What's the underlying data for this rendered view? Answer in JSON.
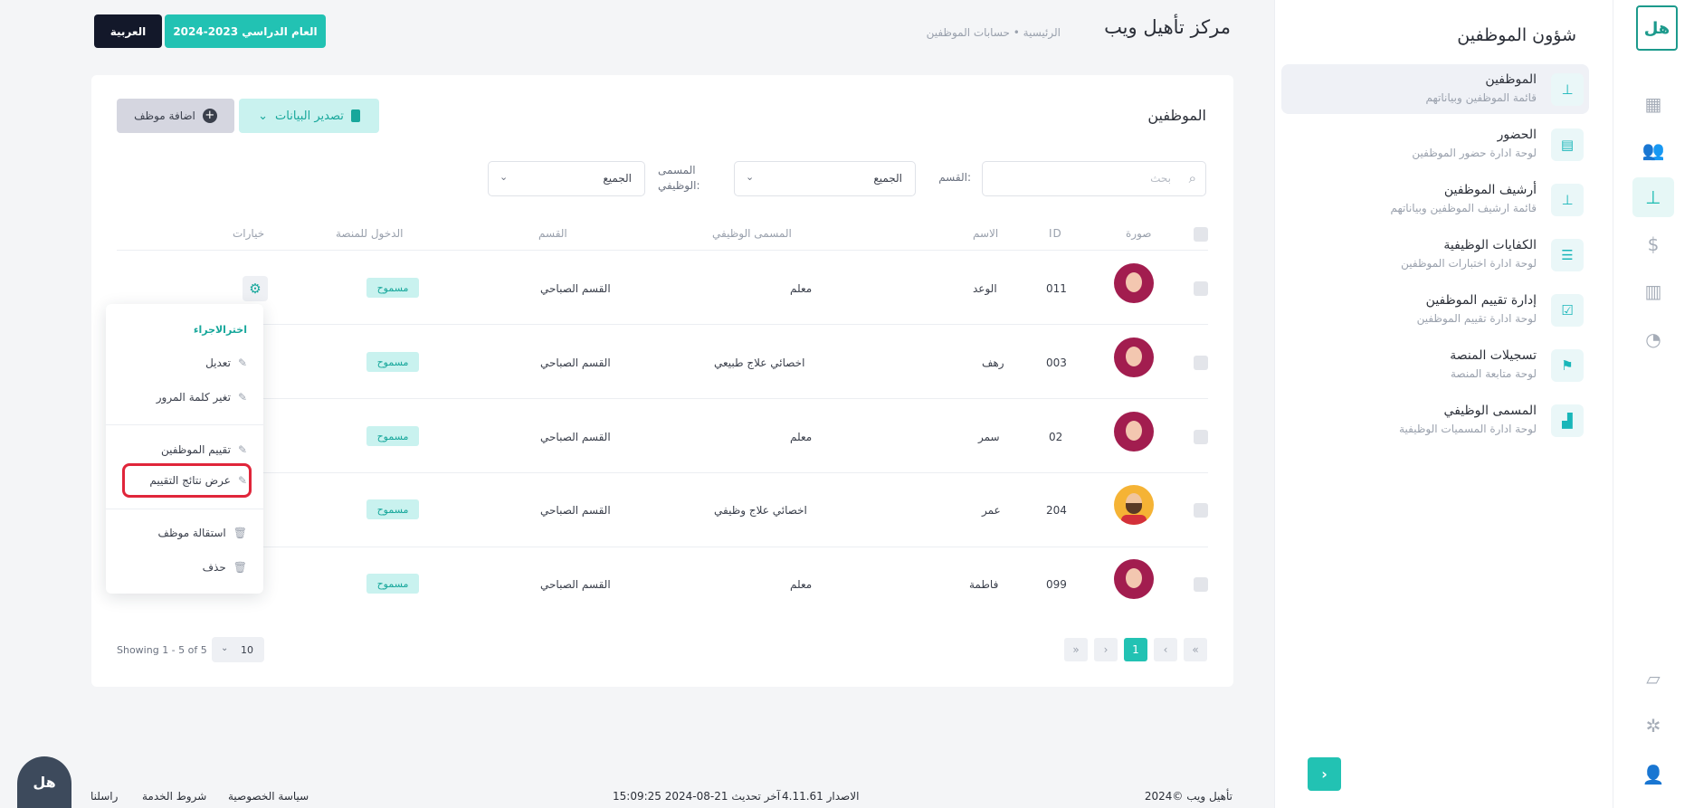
{
  "rail": {
    "logo_text": "هل",
    "icons": [
      "dashboard-icon",
      "users-icon",
      "tie-icon",
      "dollar-icon",
      "building-icon",
      "pie-icon"
    ],
    "bottom_icons": [
      "chat-icon",
      "settings-icon",
      "user-icon"
    ]
  },
  "sidebar": {
    "title": "شؤون الموظفين",
    "items": [
      {
        "title": "الموظفين",
        "subtitle": "قائمة الموظفين وبياناتهم",
        "icon": "tie-icon"
      },
      {
        "title": "الحضور",
        "subtitle": "لوحة ادارة حضور الموظفين",
        "icon": "clipboard-icon"
      },
      {
        "title": "أرشيف الموظفين",
        "subtitle": "قائمة ارشيف الموظفين وبياناتهم",
        "icon": "tie-icon"
      },
      {
        "title": "الكفايات الوظيفية",
        "subtitle": "لوحة ادارة اختبارات الموظفين",
        "icon": "list-icon"
      },
      {
        "title": "إدارة تقييم الموظفين",
        "subtitle": "لوحة ادارة تقييم الموظفين",
        "icon": "clipboard-check-icon"
      },
      {
        "title": "تسجيلات المنصة",
        "subtitle": "لوحة متابعة المنصة",
        "icon": "flag-icon"
      },
      {
        "title": "المسمى الوظيفي",
        "subtitle": "لوحة ادارة المسميات الوظيفية",
        "icon": "chart-icon"
      }
    ]
  },
  "header": {
    "brand": "مركز تأهيل ويب",
    "breadcrumb": "الرئيسية • حسابات الموظفين",
    "year_button": "العام الدراسي 2023-2024",
    "lang_button": "العربية"
  },
  "card": {
    "title": "الموظفين",
    "add_button": "اضافة موظف",
    "export_button": "تصدير البيانات",
    "search_placeholder": "بحث",
    "dept_label": "القسم:",
    "dept_value": "الجميع",
    "jobtitle_label": "المسمى الوظيفي:",
    "jobtitle_value": "الجميع"
  },
  "table": {
    "headers": {
      "photo": "صورة",
      "id": "ID",
      "name": "الاسم",
      "job": "المسمى الوظيفي",
      "dept": "القسم",
      "access": "الدخول للمنصة",
      "options": "خيارات"
    },
    "rows": [
      {
        "id": "011",
        "name": "الوعد",
        "job": "معلم",
        "dept": "القسم الصباحي",
        "access": "مسموح",
        "avatar": "woman"
      },
      {
        "id": "003",
        "name": "رهف",
        "job": "اخصائي علاج طبيعي",
        "dept": "القسم الصباحي",
        "access": "مسموح",
        "avatar": "woman"
      },
      {
        "id": "02",
        "name": "سمر",
        "job": "معلم",
        "dept": "القسم الصباحي",
        "access": "مسموح",
        "avatar": "woman"
      },
      {
        "id": "204",
        "name": "عمر",
        "job": "اخصائي علاج وظيفي",
        "dept": "القسم الصباحي",
        "access": "مسموح",
        "avatar": "man"
      },
      {
        "id": "099",
        "name": "فاطمة",
        "job": "معلم",
        "dept": "القسم الصباحي",
        "access": "مسموح",
        "avatar": "woman"
      }
    ]
  },
  "menu": {
    "title": "اخترالاجراء",
    "edit": "تعديل",
    "change_password": "تغير كلمة المرور",
    "evaluate": "تقييم الموظفين",
    "view_results": "عرض نتائج التقييم",
    "resign": "استقالة موظف",
    "delete": "حذف"
  },
  "pagination": {
    "showing": "Showing 1 - 5 of 5",
    "per_page": "10",
    "current_page": "1",
    "first": "«",
    "prev": "‹",
    "next": "›",
    "last": "»"
  },
  "footer": {
    "copyright": "2024© تأهيل ويب",
    "version": "الاصدار 4.11.61",
    "last_update": "آخر تحديث 21-08-2024 15:09:25",
    "privacy": "سياسة الخصوصية",
    "terms": "شروط الخدمة",
    "contact": "راسلنا"
  },
  "colors": {
    "accent": "#22c2b3",
    "dark": "#13182a",
    "highlight": "#e0253a",
    "avatar_woman": "#a21d4f",
    "avatar_man": "#f5b335"
  }
}
